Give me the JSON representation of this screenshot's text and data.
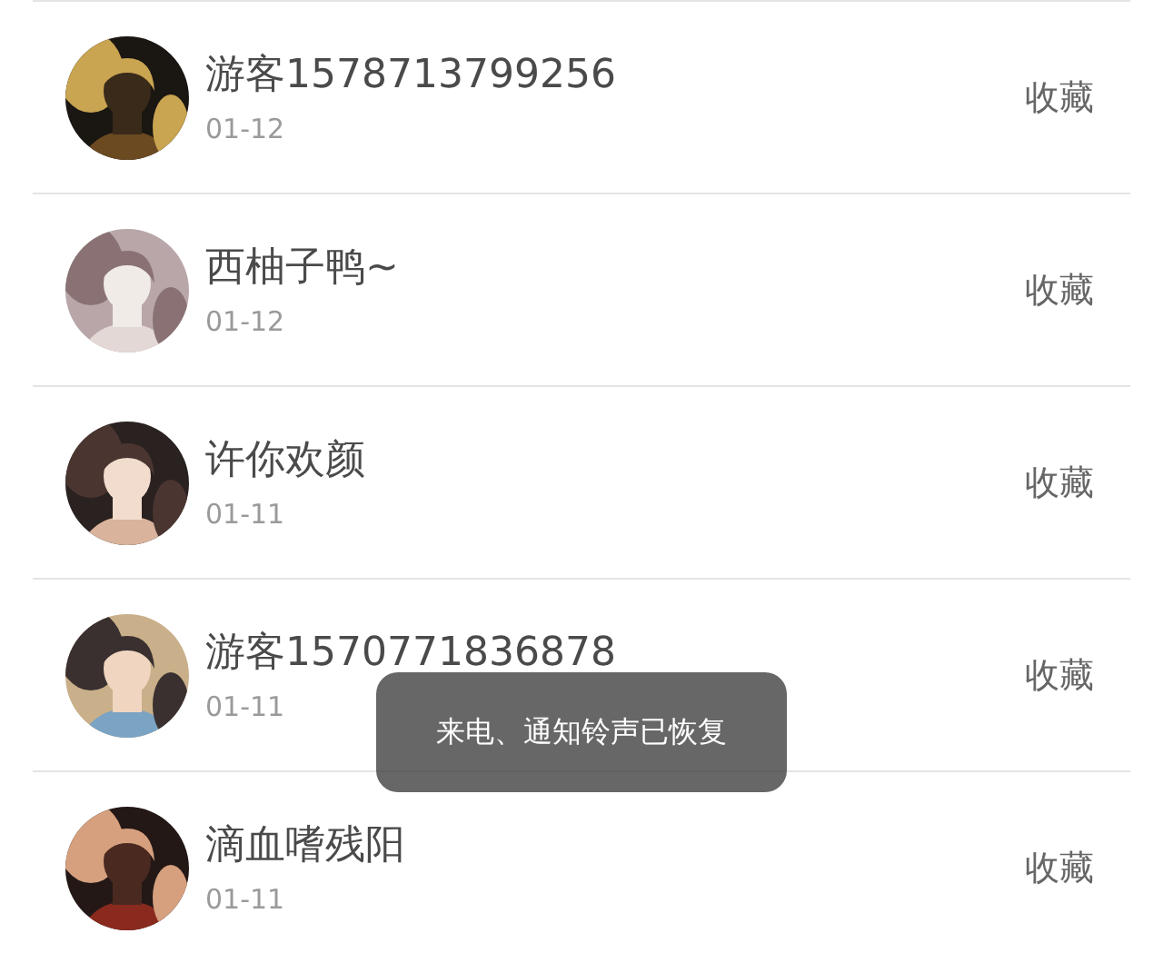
{
  "rows": [
    {
      "name": "游客1578713799256",
      "date": "01-12",
      "action": "收藏"
    },
    {
      "name": "西柚子鸭~",
      "date": "01-12",
      "action": "收藏"
    },
    {
      "name": "许你欢颜",
      "date": "01-11",
      "action": "收藏"
    },
    {
      "name": "游客1570771836878",
      "date": "01-11",
      "action": "收藏"
    },
    {
      "name": "滴血嗜残阳",
      "date": "01-11",
      "action": "收藏"
    }
  ],
  "toast": {
    "text": "来电、通知铃声已恢复"
  }
}
